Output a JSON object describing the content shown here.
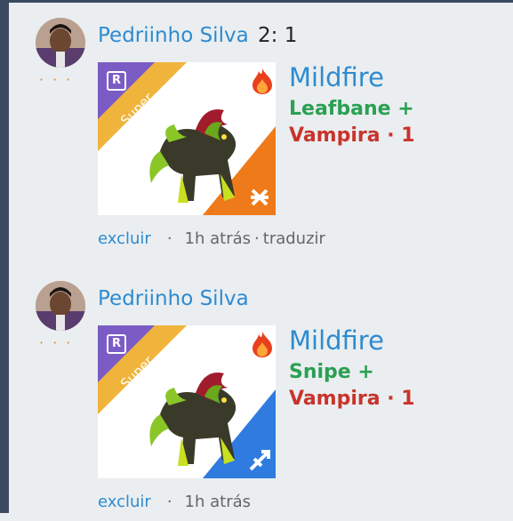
{
  "posts": [
    {
      "author": "Pedriinho Silva",
      "score": "2: 1",
      "rarity_letter": "R",
      "rarity_label": "Super",
      "dragon_name": "Mildfire",
      "skill_primary": "Leafbane +",
      "skill_secondary": "Vampira · 1",
      "delete_label": "excluir",
      "time_label": "1h atrás",
      "translate_label": "traduzir",
      "badge_color": "#ef7a1a",
      "badge_icon": "twin-arrows-icon"
    },
    {
      "author": "Pedriinho Silva",
      "rarity_letter": "R",
      "rarity_label": "Super",
      "dragon_name": "Mildfire",
      "skill_primary": "Snipe +",
      "skill_secondary": "Vampira · 1",
      "delete_label": "excluir",
      "time_label": "1h atrás",
      "badge_color": "#2f7be0",
      "badge_icon": "arrow-shot-icon"
    }
  ],
  "colors": {
    "link": "#2e8bd0",
    "skill_green": "#2aa052",
    "skill_red": "#c8342c",
    "rarity_purple": "#7b5cc4",
    "super_yellow": "#f0b43c"
  }
}
